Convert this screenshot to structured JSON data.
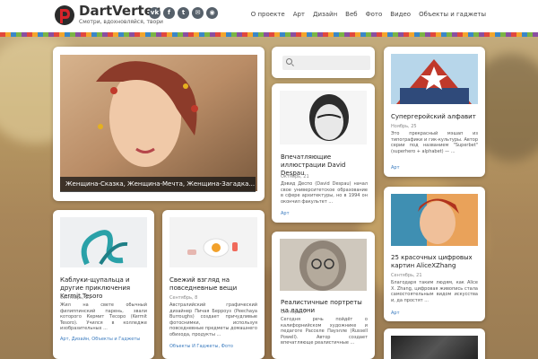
{
  "header": {
    "site_name": "DartVerter",
    "tagline": "Смотри, вдохновляйся, твори",
    "social": [
      {
        "name": "vk-icon",
        "glyph": "vk"
      },
      {
        "name": "facebook-icon",
        "glyph": "f"
      },
      {
        "name": "twitter-icon",
        "glyph": "t"
      },
      {
        "name": "email-icon",
        "glyph": "✉"
      },
      {
        "name": "rss-icon",
        "glyph": "◉"
      }
    ],
    "nav": [
      "О проекте",
      "Арт",
      "Дизайн",
      "Веб",
      "Фото",
      "Видео",
      "Объекты и гаджеты"
    ]
  },
  "featured": {
    "caption": "Женщина-Сказка, Женщина-Мечта, Женщина-Загадка..."
  },
  "search": {
    "placeholder": ""
  },
  "posts": [
    {
      "title": "Впечатляющие иллюстрации David Despau",
      "date": "Октябрь, 21",
      "excerpt": "Дэвид Деспо (David Despau) начал свое университетское образование в сфере архитектуры, но в 1994 он окончил факультет ...",
      "tags": "Арт"
    },
    {
      "title": "Супергеройский алфавит",
      "date": "Ноябрь, 25",
      "excerpt": "Это прекрасный мэшап из типографики и гик-культуры. Автор серии под названием \"Superbet\" (superhero + alphabet) — ...",
      "tags": "Арт"
    },
    {
      "title": "Каблуки-щупальца и другие приключения Kermit Tesoro",
      "date": "Сентябрь, 21",
      "excerpt": "Жил на свете обычный филиппинский парень, звали которого Кермит Тесоро (Kermit Tesoro). Учился в колледже изобразительных ...",
      "tags": [
        "Арт",
        "Дизайн",
        "Объекты и Гаджеты"
      ]
    },
    {
      "title": "Свежий взгляд на повседневные вещи",
      "date": "Сентябрь, 8",
      "excerpt": "Австралийский графический дизайнер Пичая Берроуз (Peechaya Burroughs) создает причудливые фотоснимки, используя повседневные предметы домашнего обихода, продукты ...",
      "tags": [
        "Объекты И Гаджеты",
        "Фото"
      ]
    },
    {
      "title": "Реалистичные портреты на ладони",
      "date": "Октябрь, 7",
      "excerpt": "Сегодня речь пойдёт о калифорнийском художнике и педагоге Расселе Пауэлле (Russell Powell). Автор создает впечатляюще реалистичные ...",
      "tags": ""
    },
    {
      "title": "25 красочных цифровых картин AliceXZhang",
      "date": "Сентябрь, 21",
      "excerpt": "Благодаря таким людям, как Alice X. Zhang, цифровая живопись стала самостоятельным видом искусства и, да простят ...",
      "tags": "Арт"
    }
  ]
}
